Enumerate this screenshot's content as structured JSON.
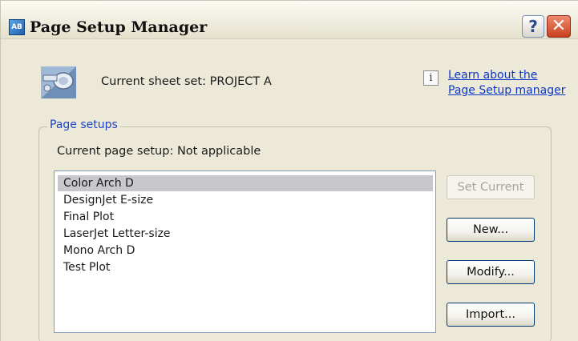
{
  "window": {
    "title": "Page Setup Manager",
    "app_icon_text": "AB",
    "help_button": "?",
    "close_button": "✕"
  },
  "sheet_set": {
    "label": "Current sheet set:  PROJECT A"
  },
  "learn_link": {
    "line1": "Learn about the",
    "line2": "Page Setup manager"
  },
  "page_setups": {
    "group_label": "Page setups",
    "current_label": "Current page setup:  Not applicable",
    "items": [
      "Color Arch D",
      "DesignJet E-size",
      "Final Plot",
      "LaserJet Letter-size",
      "Mono Arch D",
      "Test Plot"
    ],
    "selected_item": "Color Arch D"
  },
  "buttons": {
    "set_current": "Set Current",
    "new": "New...",
    "modify": "Modify...",
    "import": "Import..."
  },
  "colors": {
    "dialog_bg": "#ece9d8",
    "link": "#0b37c8",
    "group_label": "#1c44c4",
    "selection": "#c8c7cb"
  }
}
